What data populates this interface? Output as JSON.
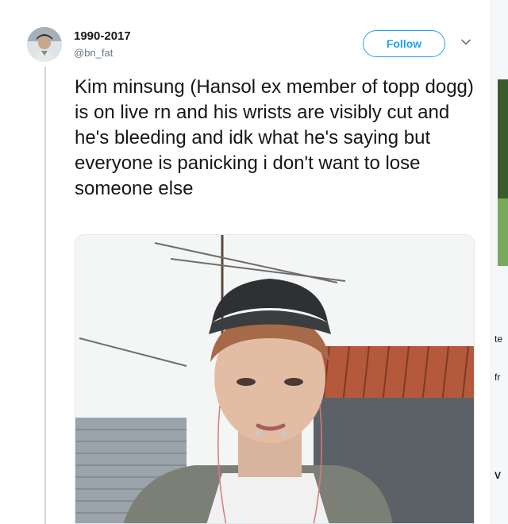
{
  "tweet": {
    "display_name": "1990-2017",
    "handle": "@bn_fat",
    "follow_label": "Follow",
    "text": "Kim minsung (Hansol ex member of topp dogg) is on live rn and his wrists are visibly cut and he's bleeding and idk what he's saying but everyone is panicking i don't want to lose someone else"
  },
  "icons": {
    "menu": "chevron-down-icon",
    "avatar": "profile-photo",
    "media": "photo"
  },
  "sidebar_fragments": {
    "a": "te",
    "b": "fr",
    "c": "V"
  },
  "colors": {
    "accent": "#1da1f2",
    "text": "#14171a",
    "secondary": "#657786",
    "thread": "#ccd6dd"
  }
}
